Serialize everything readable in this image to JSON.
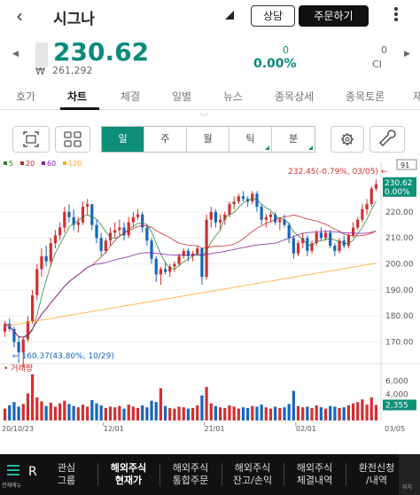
{
  "header": {
    "title": "시그나",
    "consult_label": "상담",
    "order_label": "주문하기"
  },
  "quote": {
    "price": "230.62",
    "currency_symbol": "₩",
    "krw_price": "261,292",
    "change": "0",
    "change_pct": "0.00%",
    "volume": "0",
    "ci_label": "CI"
  },
  "tabs": [
    "호가",
    "차트",
    "체결",
    "일별",
    "뉴스",
    "종목상세",
    "종목토론",
    "재"
  ],
  "active_tab": "차트",
  "toolbar": {
    "periods": [
      "일",
      "주",
      "월",
      "틱",
      "분"
    ],
    "active_period": "일"
  },
  "chart_data": {
    "type": "candlestick",
    "legend": [
      {
        "label": "5",
        "color": "#2e7d32"
      },
      {
        "label": "20",
        "color": "#c62828"
      },
      {
        "label": "60",
        "color": "#7b1fa2"
      },
      {
        "label": "120",
        "color": "#f9a825"
      }
    ],
    "y_ticks": [
      "220.00",
      "210.00",
      "200.00",
      "190.00",
      "180.00",
      "170.00"
    ],
    "ylim": [
      163,
      236
    ],
    "last_price_label": "230.62",
    "last_price_pct_label": "0.00%",
    "count_badge": "91",
    "max_annotation": "232.45(-0.79%, 03/05)",
    "min_annotation": "160.37(43.80%, 10/29)",
    "volume_label": "거래량",
    "volume_ticks": [
      "6,000",
      "4,000",
      "2,000"
    ],
    "volume_ylim": [
      0,
      7000
    ],
    "last_volume_label": "2,355",
    "x_labels": [
      "20/10/23",
      "12/01",
      "21/01",
      "02/01",
      "03/05"
    ],
    "candles": [
      [
        174,
        178,
        172,
        177,
        1800
      ],
      [
        177,
        179,
        174,
        175,
        2300
      ],
      [
        175,
        176,
        168,
        170,
        2800
      ],
      [
        170,
        172,
        162,
        166,
        2100
      ],
      [
        166,
        172,
        160.4,
        171,
        2500
      ],
      [
        171,
        180,
        170,
        178,
        4100
      ],
      [
        178,
        190,
        177,
        188,
        7000
      ],
      [
        188,
        200,
        186,
        198,
        3500
      ],
      [
        198,
        206,
        195,
        203,
        2900
      ],
      [
        203,
        207,
        199,
        201,
        2200
      ],
      [
        201,
        210,
        199,
        208,
        2700
      ],
      [
        208,
        213,
        206,
        211,
        2100
      ],
      [
        211,
        216,
        209,
        214,
        2600
      ],
      [
        214,
        222,
        212,
        220,
        3000
      ],
      [
        220,
        223,
        216,
        218,
        2500
      ],
      [
        218,
        221,
        213,
        215,
        2200
      ],
      [
        215,
        218,
        212,
        216,
        2000
      ],
      [
        216,
        224,
        215,
        222,
        2400
      ],
      [
        222,
        225,
        219,
        223,
        2100
      ],
      [
        223,
        223,
        213,
        215,
        3100
      ],
      [
        215,
        217,
        208,
        210,
        2600
      ],
      [
        210,
        212,
        203,
        205,
        2300
      ],
      [
        205,
        210,
        204,
        209,
        1900
      ],
      [
        209,
        214,
        207,
        212,
        2100
      ],
      [
        212,
        216,
        210,
        213,
        2000
      ],
      [
        213,
        217,
        211,
        214,
        2200
      ],
      [
        214,
        216,
        209,
        211,
        1800
      ],
      [
        211,
        218,
        210,
        216,
        2400
      ],
      [
        216,
        220,
        214,
        218,
        2100
      ],
      [
        218,
        221,
        217,
        219,
        1900
      ],
      [
        219,
        220,
        212,
        214,
        2300
      ],
      [
        214,
        215,
        207,
        209,
        2000
      ],
      [
        209,
        210,
        200,
        202,
        3000
      ],
      [
        202,
        203,
        193,
        196,
        2800
      ],
      [
        196,
        199,
        192,
        198,
        4900
      ],
      [
        198,
        201,
        196,
        197,
        2200
      ],
      [
        197,
        200,
        195,
        199,
        1900
      ],
      [
        199,
        201,
        197,
        200,
        1800
      ],
      [
        200,
        204,
        199,
        203,
        2100
      ],
      [
        203,
        206,
        202,
        205,
        2000
      ],
      [
        205,
        206,
        201,
        203,
        1800
      ],
      [
        203,
        205,
        201,
        204,
        1900
      ],
      [
        204,
        207,
        203,
        206,
        2300
      ],
      [
        206,
        206,
        192,
        195,
        3800
      ],
      [
        195,
        219,
        194,
        217,
        5100
      ],
      [
        217,
        222,
        214,
        220,
        2600
      ],
      [
        220,
        221,
        214,
        216,
        2200
      ],
      [
        216,
        219,
        213,
        217,
        2000
      ],
      [
        217,
        220,
        215,
        219,
        1900
      ],
      [
        219,
        224,
        218,
        223,
        2300
      ],
      [
        223,
        226,
        221,
        224,
        2100
      ],
      [
        224,
        227,
        223,
        226,
        1800
      ],
      [
        226,
        228,
        224,
        225,
        2000
      ],
      [
        225,
        226,
        222,
        224,
        1900
      ],
      [
        224,
        228,
        223,
        227,
        2200
      ],
      [
        227,
        228,
        220,
        222,
        2100
      ],
      [
        222,
        223,
        215,
        217,
        2400
      ],
      [
        217,
        219,
        214,
        218,
        2000
      ],
      [
        218,
        220,
        216,
        219,
        1800
      ],
      [
        219,
        220,
        215,
        216,
        2100
      ],
      [
        216,
        218,
        213,
        217,
        1900
      ],
      [
        217,
        219,
        214,
        215,
        2000
      ],
      [
        215,
        216,
        208,
        210,
        2500
      ],
      [
        210,
        211,
        202,
        204,
        4500
      ],
      [
        204,
        209,
        203,
        208,
        2200
      ],
      [
        208,
        212,
        206,
        210,
        2000
      ],
      [
        210,
        211,
        203,
        205,
        2100
      ],
      [
        205,
        209,
        204,
        208,
        1900
      ],
      [
        208,
        213,
        207,
        212,
        2300
      ],
      [
        212,
        214,
        209,
        210,
        2000
      ],
      [
        210,
        213,
        209,
        212,
        1800
      ],
      [
        212,
        213,
        206,
        207,
        2200
      ],
      [
        207,
        208,
        203,
        205,
        2100
      ],
      [
        205,
        210,
        204,
        209,
        1900
      ],
      [
        209,
        211,
        206,
        207,
        2000
      ],
      [
        207,
        212,
        206,
        211,
        2300
      ],
      [
        211,
        216,
        210,
        214,
        2600
      ],
      [
        214,
        218,
        213,
        217,
        2800
      ],
      [
        217,
        223,
        216,
        221,
        3200
      ],
      [
        221,
        225,
        219,
        223,
        2400
      ],
      [
        223,
        230,
        222,
        229,
        3500
      ],
      [
        229,
        232.45,
        228,
        230.62,
        2355
      ]
    ]
  },
  "bottom_nav": {
    "menu_label": "전체메뉴",
    "r_label": "R",
    "items": [
      "관심\n그룹",
      "해외주식\n현재가",
      "해외주식\n통합주문",
      "해외주식\n잔고/손익",
      "해외주식\n체결내역",
      "환전신청\n/내역"
    ],
    "active_index": 1,
    "right_label": "위치"
  },
  "colors": {
    "accent": "#0e8f78",
    "up": "#d32f2f",
    "down": "#1565c0"
  }
}
